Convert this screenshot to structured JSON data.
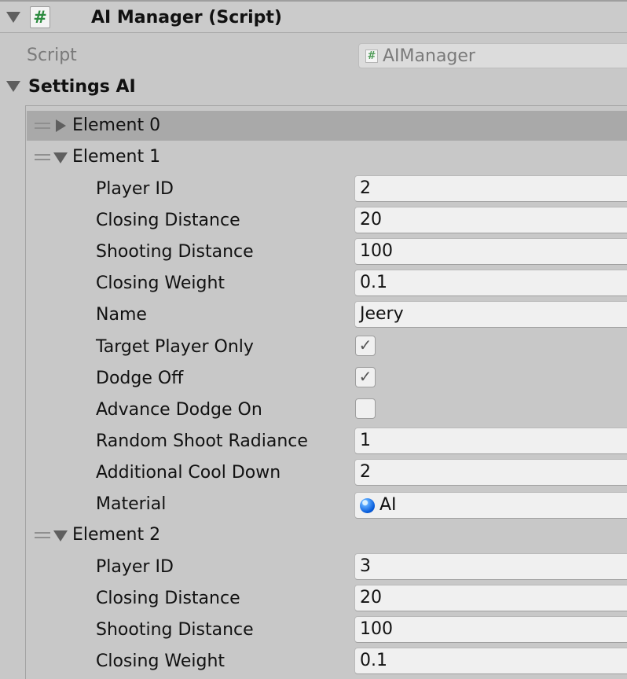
{
  "component": {
    "title": "AI Manager (Script)"
  },
  "script_field": {
    "label": "Script",
    "value": "AIManager"
  },
  "settings_ai": {
    "label": "Settings AI",
    "elements": [
      {
        "label": "Element 0"
      },
      {
        "label": "Element 1",
        "player_id_label": "Player ID",
        "player_id": "2",
        "closing_distance_label": "Closing Distance",
        "closing_distance": "20",
        "shooting_distance_label": "Shooting Distance",
        "shooting_distance": "100",
        "closing_weight_label": "Closing Weight",
        "closing_weight": "0.1",
        "name_label": "Name",
        "name": "Jeery",
        "target_player_only_label": "Target Player Only",
        "target_player_only": true,
        "dodge_off_label": "Dodge Off",
        "dodge_off": true,
        "advance_dodge_on_label": "Advance Dodge On",
        "advance_dodge_on": false,
        "random_shoot_radiance_label": "Random Shoot Radiance",
        "random_shoot_radiance": "1",
        "additional_cool_down_label": "Additional Cool Down",
        "additional_cool_down": "2",
        "material_label": "Material",
        "material": "AI"
      },
      {
        "label": "Element 2",
        "player_id_label": "Player ID",
        "player_id": "3",
        "closing_distance_label": "Closing Distance",
        "closing_distance": "20",
        "shooting_distance_label": "Shooting Distance",
        "shooting_distance": "100",
        "closing_weight_label": "Closing Weight",
        "closing_weight": "0.1"
      }
    ]
  },
  "icons": {
    "script": "script-hash-icon",
    "material": "blue-sphere-icon",
    "checkmark": "✓"
  },
  "colors": {
    "panel_bg": "#c8c8c8",
    "selected_row": "#a9a9a9",
    "field_bg": "#f0f0f0",
    "script_hash": "#2b8a3e",
    "material_blue": "#0559d8"
  }
}
